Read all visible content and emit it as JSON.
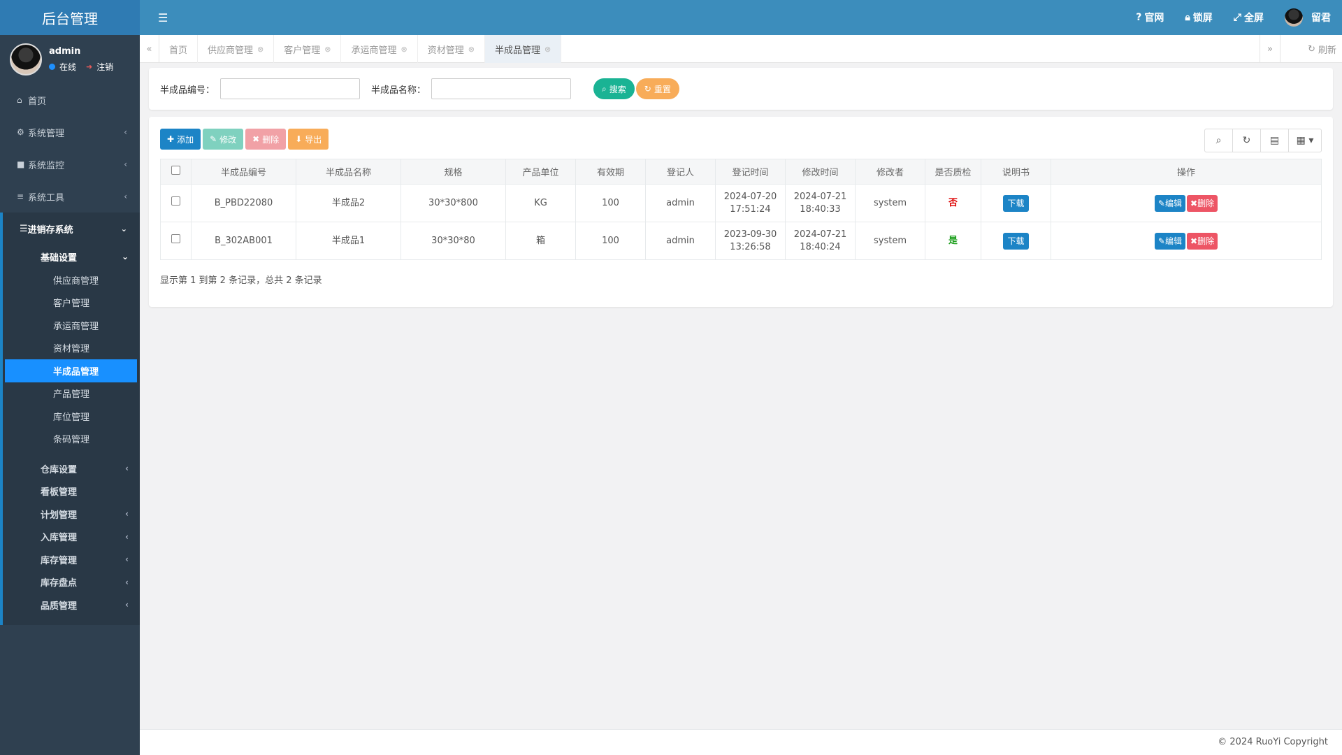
{
  "app": {
    "title": "后台管理"
  },
  "user": {
    "name": "admin",
    "status": "在线",
    "logout": "注销"
  },
  "menu": {
    "home": "首页",
    "system_mgmt": "系统管理",
    "system_monitor": "系统监控",
    "system_tools": "系统工具",
    "jxc": "进销存系统",
    "basic_settings": "基础设置",
    "basic_items": [
      "供应商管理",
      "客户管理",
      "承运商管理",
      "资材管理",
      "半成品管理",
      "产品管理",
      "库位管理",
      "条码管理"
    ],
    "other_items": [
      "仓库设置",
      "看板管理",
      "计划管理",
      "入库管理",
      "库存管理",
      "库存盘点",
      "品质管理"
    ]
  },
  "topbar": {
    "official": "官网",
    "lock": "锁屏",
    "fullscreen": "全屏",
    "username": "留君"
  },
  "tabs": [
    "首页",
    "供应商管理",
    "客户管理",
    "承运商管理",
    "资材管理",
    "半成品管理"
  ],
  "refresh_label": "刷新",
  "search": {
    "code_label": "半成品编号：",
    "code_value": "",
    "name_label": "半成品名称：",
    "name_value": "",
    "search_btn": "搜索",
    "reset_btn": "重置"
  },
  "toolbar": {
    "add": "添加",
    "edit": "修改",
    "delete": "删除",
    "export": "导出"
  },
  "table": {
    "headers": [
      "半成品编号",
      "半成品名称",
      "规格",
      "产品单位",
      "有效期",
      "登记人",
      "登记时间",
      "修改时间",
      "修改者",
      "是否质检",
      "说明书",
      "操作"
    ],
    "rows": [
      {
        "code": "B_PBD22080",
        "name": "半成品2",
        "spec": "30*30*800",
        "unit": "KG",
        "validity": "100",
        "registrant": "admin",
        "reg_date": "2024-07-20",
        "reg_time": "17:51:24",
        "mod_date": "2024-07-21",
        "mod_time": "18:40:33",
        "modifier": "system",
        "qc": "否",
        "manual": "下载",
        "edit": "编辑",
        "delete": "删除"
      },
      {
        "code": "B_302AB001",
        "name": "半成品1",
        "spec": "30*30*80",
        "unit": "箱",
        "validity": "100",
        "registrant": "admin",
        "reg_date": "2023-09-30",
        "reg_time": "13:26:58",
        "mod_date": "2024-07-21",
        "mod_time": "18:40:24",
        "modifier": "system",
        "qc": "是",
        "manual": "下载",
        "edit": "编辑",
        "delete": "删除"
      }
    ]
  },
  "pager_info": "显示第 1 到第 2 条记录，总共 2 条记录",
  "footer": "© 2024 RuoYi Copyright"
}
